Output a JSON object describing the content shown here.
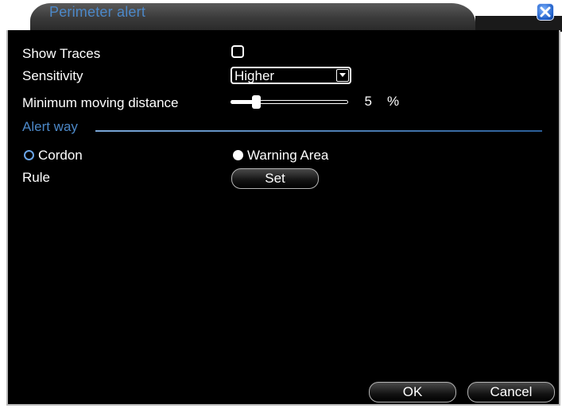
{
  "window": {
    "title": "Perimeter alert",
    "accent_color": "#4c88c8",
    "close_icon": "close-x-icon"
  },
  "form": {
    "show_traces": {
      "label": "Show Traces",
      "checked": false
    },
    "sensitivity": {
      "label": "Sensitivity",
      "value": "Higher"
    },
    "min_distance": {
      "label": "Minimum moving distance",
      "value": "5",
      "unit": "%",
      "level": 0.2
    }
  },
  "alert_way": {
    "title": "Alert way",
    "options": [
      {
        "label": "Cordon",
        "selected": false
      },
      {
        "label": "Warning Area",
        "selected": true
      }
    ],
    "rule": {
      "label": "Rule",
      "button": "Set"
    }
  },
  "footer": {
    "ok": "OK",
    "cancel": "Cancel"
  }
}
